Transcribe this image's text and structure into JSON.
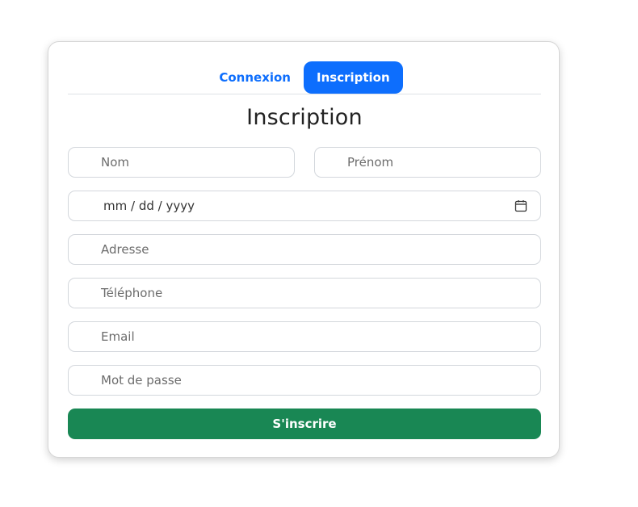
{
  "tabs": [
    {
      "label": "Connexion",
      "active": false
    },
    {
      "label": "Inscription",
      "active": true
    }
  ],
  "form": {
    "title": "Inscription",
    "fields": {
      "nom": {
        "placeholder": "Nom"
      },
      "prenom": {
        "placeholder": "Prénom"
      },
      "date": {
        "value": "mm / dd / yyyy"
      },
      "adresse": {
        "placeholder": "Adresse"
      },
      "telephone": {
        "placeholder": "Téléphone"
      },
      "email": {
        "placeholder": "Email"
      },
      "password": {
        "placeholder": "Mot de passe"
      }
    },
    "submit_label": "S'inscrire"
  },
  "colors": {
    "primary": "#0d6efd",
    "success": "#198754"
  },
  "icons": {
    "date": "calendar-icon"
  }
}
